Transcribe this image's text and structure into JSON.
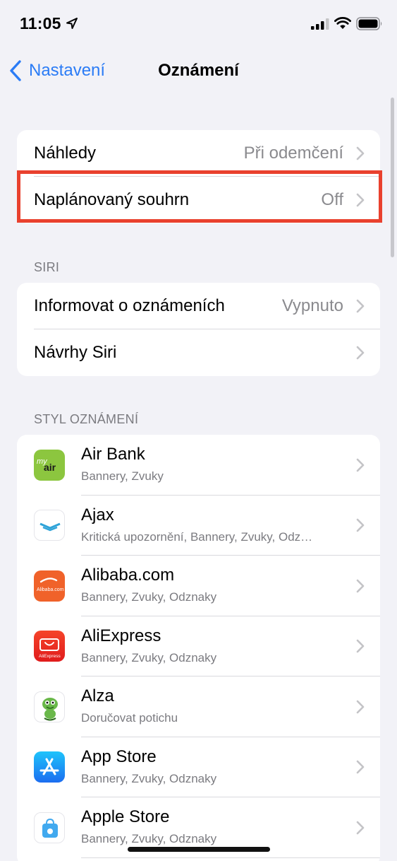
{
  "status_bar": {
    "time": "11:05"
  },
  "nav": {
    "back_label": "Nastavení",
    "title": "Oznámení"
  },
  "group1": [
    {
      "label": "Náhledy",
      "value": "Při odemčení"
    },
    {
      "label": "Naplánovaný souhrn",
      "value": "Off"
    }
  ],
  "siri": {
    "header": "SIRI",
    "items": [
      {
        "label": "Informovat o oznámeních",
        "value": "Vypnuto"
      },
      {
        "label": "Návrhy Siri",
        "value": ""
      }
    ]
  },
  "styl": {
    "header": "STYL OZNÁMENÍ",
    "apps": [
      {
        "name": "Air Bank",
        "sub": "Bannery, Zvuky",
        "icon": "air-bank-icon"
      },
      {
        "name": "Ajax",
        "sub": "Kritická upozornění, Bannery, Zvuky, Odz…",
        "icon": "ajax-icon"
      },
      {
        "name": "Alibaba.com",
        "sub": "Bannery, Zvuky, Odznaky",
        "icon": "alibaba-icon"
      },
      {
        "name": "AliExpress",
        "sub": "Bannery, Zvuky, Odznaky",
        "icon": "aliexpress-icon"
      },
      {
        "name": "Alza",
        "sub": "Doručovat potichu",
        "icon": "alza-icon"
      },
      {
        "name": "App Store",
        "sub": "Bannery, Zvuky, Odznaky",
        "icon": "app-store-icon"
      },
      {
        "name": "Apple Store",
        "sub": "Bannery, Zvuky, Odznaky",
        "icon": "apple-store-icon"
      }
    ]
  },
  "icon_text": {
    "air_bank_my": "my",
    "air_bank_air": "air",
    "alibaba": "Alibaba.com",
    "aliexpress": "AliExpress"
  },
  "colors": {
    "accent": "#2b7cf6",
    "highlight": "#e9412e",
    "background": "#f2f2f7"
  }
}
